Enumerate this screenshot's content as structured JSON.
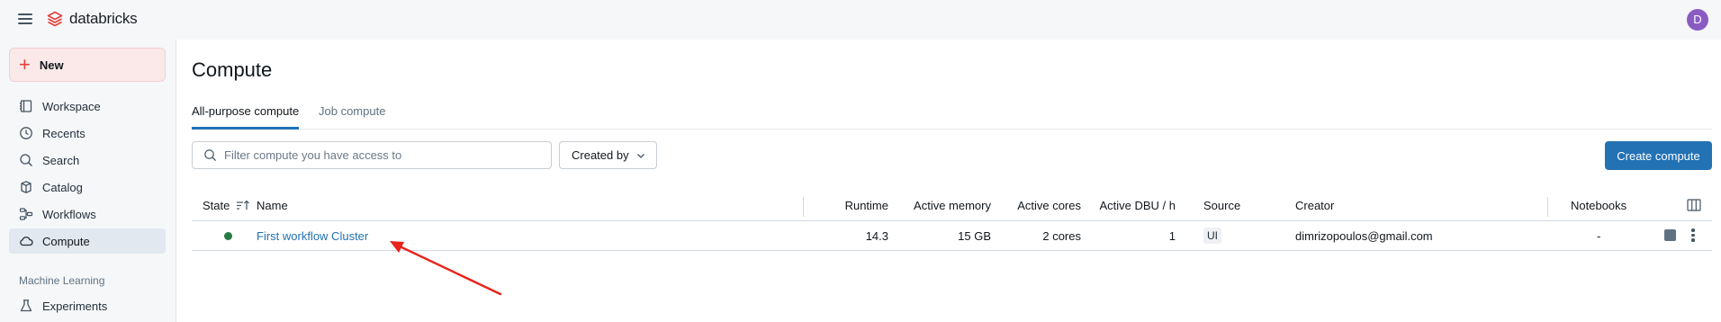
{
  "topbar": {
    "brand": "databricks",
    "avatar_initial": "D"
  },
  "sidebar": {
    "new_label": "New",
    "items": [
      {
        "label": "Workspace",
        "icon": "workspace-icon"
      },
      {
        "label": "Recents",
        "icon": "clock-icon"
      },
      {
        "label": "Search",
        "icon": "search-icon"
      },
      {
        "label": "Catalog",
        "icon": "catalog-icon"
      },
      {
        "label": "Workflows",
        "icon": "workflows-icon"
      },
      {
        "label": "Compute",
        "icon": "cloud-icon",
        "active": true
      }
    ],
    "section_ml": "Machine Learning",
    "ml_items": [
      {
        "label": "Experiments",
        "icon": "flask-icon"
      }
    ]
  },
  "main": {
    "title": "Compute",
    "tabs": [
      {
        "label": "All-purpose compute",
        "active": true
      },
      {
        "label": "Job compute"
      }
    ],
    "search": {
      "placeholder": "Filter compute you have access to",
      "value": ""
    },
    "filter_label": "Created by",
    "create_label": "Create compute",
    "table": {
      "headers": {
        "state": "State",
        "name": "Name",
        "runtime": "Runtime",
        "memory": "Active memory",
        "cores": "Active cores",
        "dbu": "Active DBU / h",
        "source": "Source",
        "creator": "Creator",
        "notebooks": "Notebooks"
      },
      "rows": [
        {
          "state": "running",
          "name": "First workflow Cluster",
          "runtime": "14.3",
          "memory": "15 GB",
          "cores": "2 cores",
          "dbu": "1",
          "source": "UI",
          "creator": "dimrizopoulos@gmail.com",
          "notebooks": "-"
        }
      ]
    }
  },
  "colors": {
    "accent": "#2272b4",
    "brand": "#e0403a",
    "running": "#277c43",
    "annotation_arrow": "#e8241c",
    "avatar": "#8a5cc2"
  }
}
